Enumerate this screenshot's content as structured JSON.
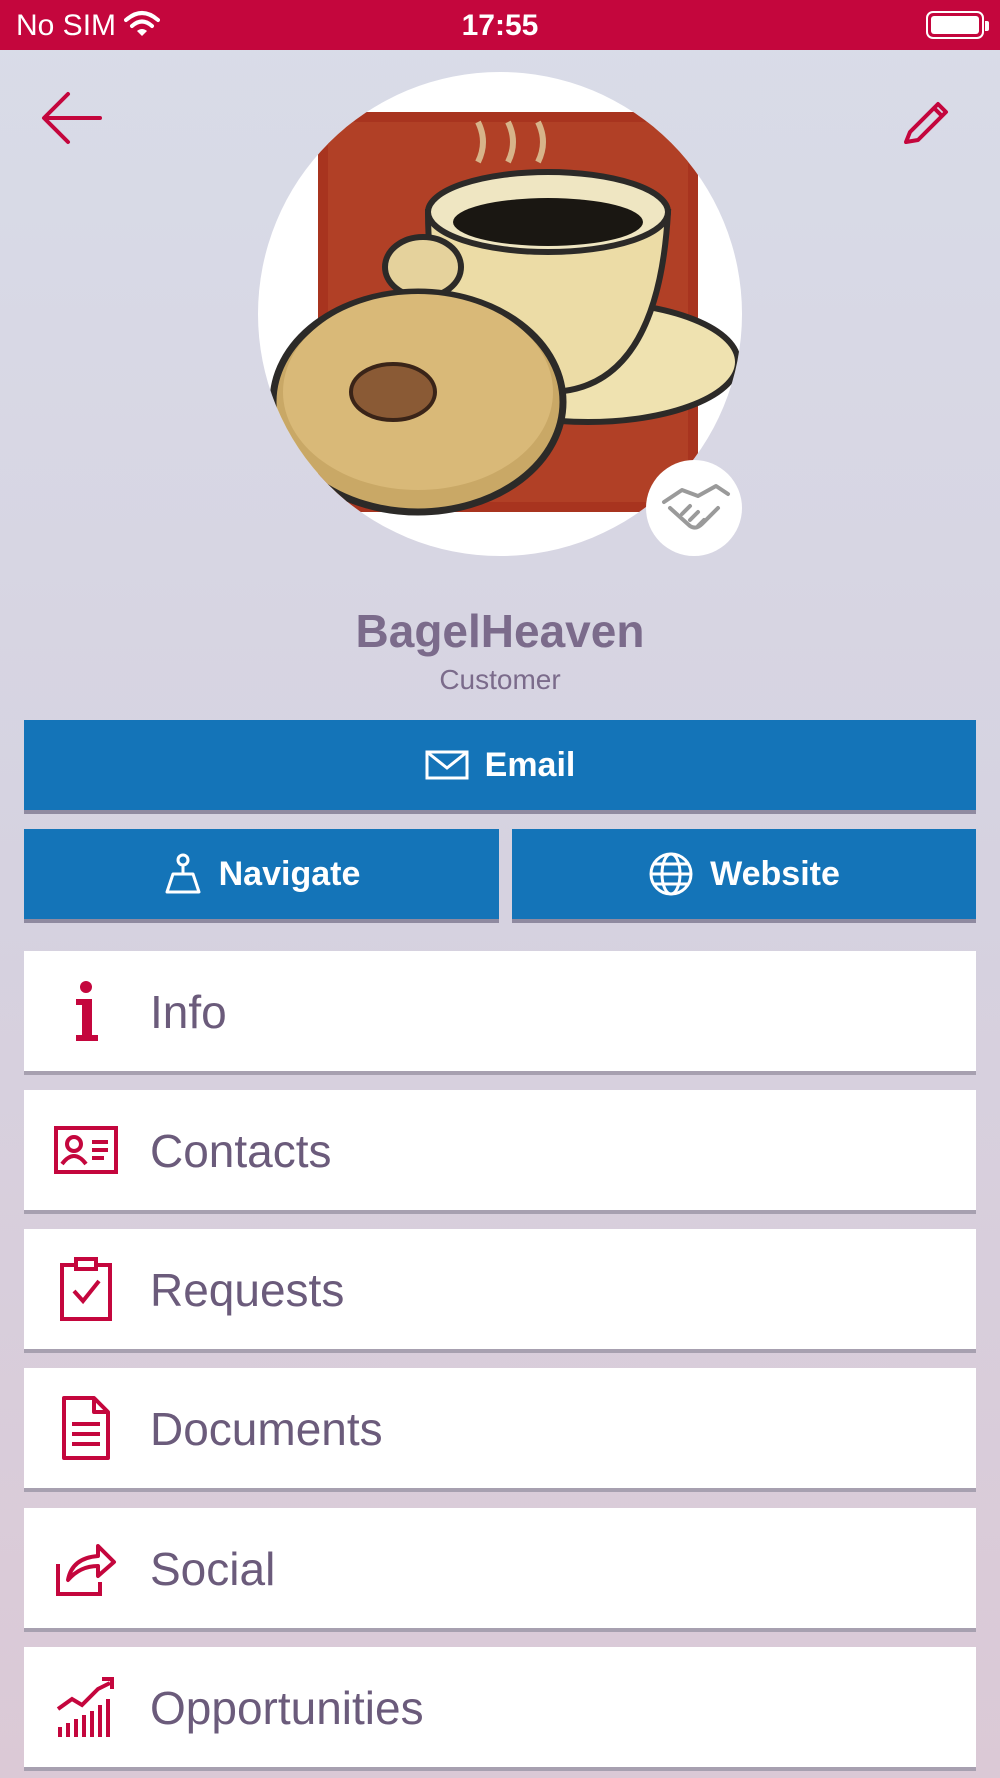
{
  "status_bar": {
    "carrier": "No SIM",
    "time": "17:55"
  },
  "header": {
    "back_icon": "arrow-left-icon",
    "edit_icon": "pencil-icon"
  },
  "profile": {
    "name": "BagelHeaven",
    "type": "Customer",
    "avatar": "bagel-and-coffee-image",
    "badge_icon": "handshake-icon"
  },
  "actions": {
    "email_label": "Email",
    "navigate_label": "Navigate",
    "website_label": "Website"
  },
  "menu": [
    {
      "label": "Info",
      "icon": "info-icon"
    },
    {
      "label": "Contacts",
      "icon": "contact-card-icon"
    },
    {
      "label": "Requests",
      "icon": "clipboard-check-icon"
    },
    {
      "label": "Documents",
      "icon": "document-icon"
    },
    {
      "label": "Social",
      "icon": "share-icon"
    },
    {
      "label": "Opportunities",
      "icon": "growth-chart-icon"
    }
  ],
  "colors": {
    "accent": "#c4063d",
    "button_blue": "#1474b8",
    "text": "#6b5b7b"
  }
}
